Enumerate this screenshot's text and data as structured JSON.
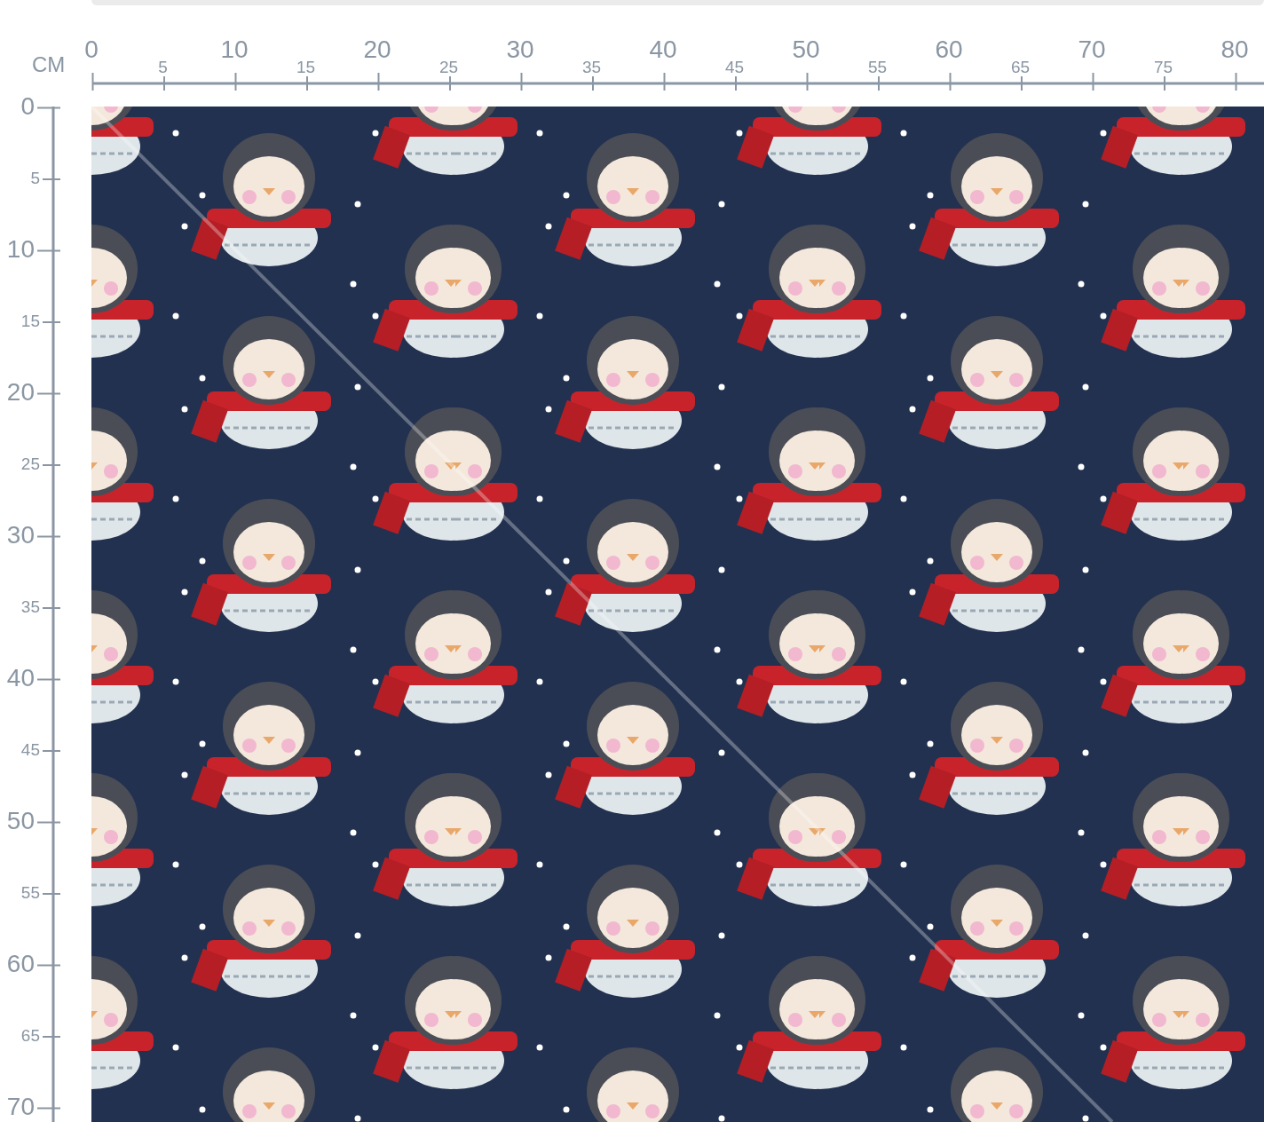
{
  "ruler": {
    "unit": "CM",
    "top_labels": [
      {
        "text": "0",
        "kind": "major"
      },
      {
        "text": "5",
        "kind": "minor"
      },
      {
        "text": "10",
        "kind": "major"
      },
      {
        "text": "15",
        "kind": "minor"
      },
      {
        "text": "20",
        "kind": "major"
      },
      {
        "text": "25",
        "kind": "minor"
      },
      {
        "text": "30",
        "kind": "major"
      },
      {
        "text": "35",
        "kind": "minor"
      },
      {
        "text": "40",
        "kind": "major"
      },
      {
        "text": "45",
        "kind": "minor"
      },
      {
        "text": "50",
        "kind": "major"
      },
      {
        "text": "55",
        "kind": "minor"
      },
      {
        "text": "60",
        "kind": "major"
      },
      {
        "text": "65",
        "kind": "minor"
      },
      {
        "text": "70",
        "kind": "major"
      },
      {
        "text": "75",
        "kind": "minor"
      },
      {
        "text": "80",
        "kind": "major"
      }
    ],
    "left_labels": [
      {
        "text": "0",
        "kind": "major"
      },
      {
        "text": "5",
        "kind": "minor"
      },
      {
        "text": "10",
        "kind": "major"
      },
      {
        "text": "15",
        "kind": "minor"
      },
      {
        "text": "20",
        "kind": "major"
      },
      {
        "text": "25",
        "kind": "minor"
      },
      {
        "text": "30",
        "kind": "major"
      },
      {
        "text": "35",
        "kind": "minor"
      },
      {
        "text": "40",
        "kind": "major"
      },
      {
        "text": "45",
        "kind": "minor"
      },
      {
        "text": "50",
        "kind": "major"
      },
      {
        "text": "55",
        "kind": "minor"
      },
      {
        "text": "60",
        "kind": "major"
      },
      {
        "text": "65",
        "kind": "minor"
      },
      {
        "text": "70",
        "kind": "major"
      }
    ]
  }
}
